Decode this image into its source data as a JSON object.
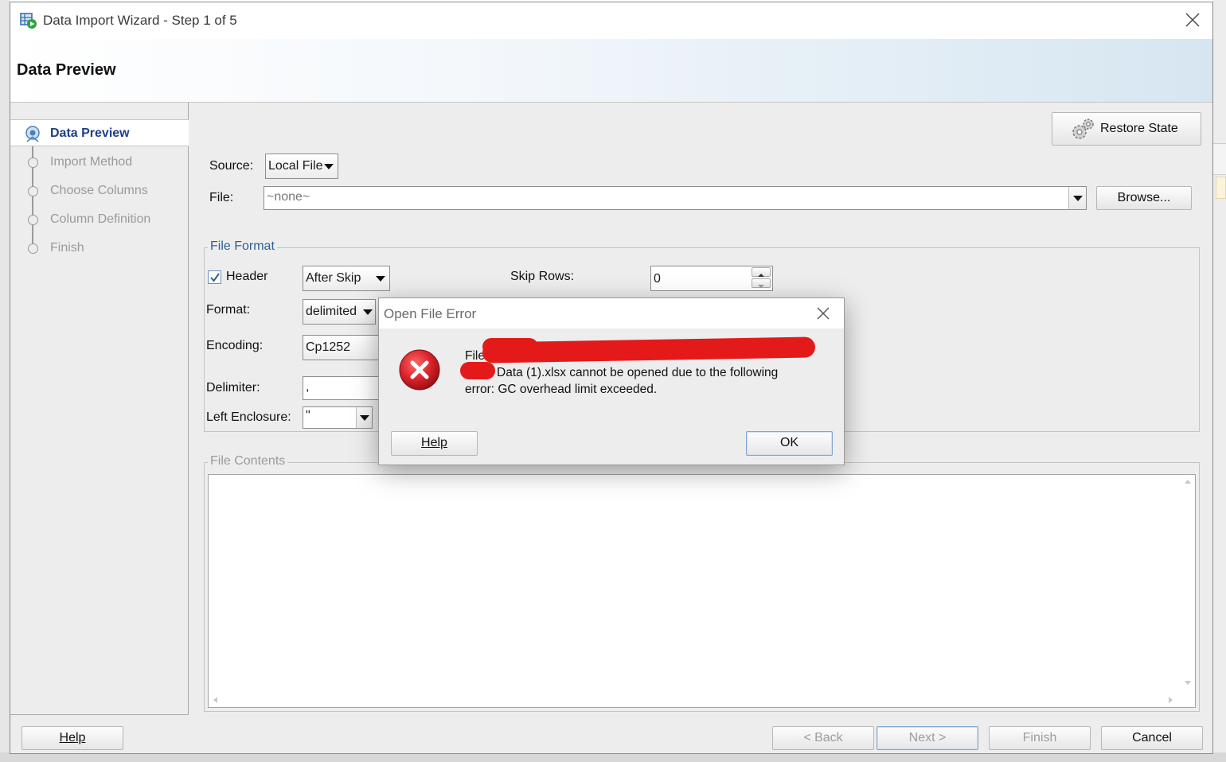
{
  "window": {
    "title": "Data Import Wizard - Step 1 of 5",
    "header_title": "Data Preview"
  },
  "nav": {
    "items": [
      {
        "label": "Data Preview",
        "state": "active"
      },
      {
        "label": "Import Method",
        "state": "disabled"
      },
      {
        "label": "Choose Columns",
        "state": "disabled"
      },
      {
        "label": "Column Definition",
        "state": "disabled"
      },
      {
        "label": "Finish",
        "state": "disabled"
      }
    ]
  },
  "toolbar": {
    "restore_state_label": "Restore State"
  },
  "source": {
    "label": "Source:",
    "value": "Local File"
  },
  "file": {
    "label": "File:",
    "value": "~none~",
    "browse_label": "Browse..."
  },
  "file_format": {
    "title": "File Format",
    "header_label": "Header",
    "header_checked": true,
    "header_option": "After Skip",
    "skip_rows_label": "Skip Rows:",
    "skip_rows_value": "0",
    "format_label": "Format:",
    "format_value": "delimited",
    "encoding_label": "Encoding:",
    "encoding_value": "Cp1252",
    "delimiter_label": "Delimiter:",
    "delimiter_value": ",",
    "left_enclosure_label": "Left Enclosure:",
    "left_enclosure_value": "\""
  },
  "file_contents": {
    "title": "File Contents"
  },
  "footer": {
    "help_label": "Help",
    "back_label": "< Back",
    "next_label": "Next >",
    "finish_label": "Finish",
    "cancel_label": "Cancel"
  },
  "error_dialog": {
    "title": "Open File Error",
    "line1_prefix": "File",
    "line2": "Data (1).xlsx cannot be opened due to the following",
    "line3": "error: GC overhead limit exceeded.",
    "help_label": "Help",
    "ok_label": "OK",
    "icon": "error-x-icon",
    "icon_color": "#d9232a"
  },
  "colors": {
    "accent": "#1d3f8a",
    "group_title": "#2f5f96",
    "redaction": "#e41a1a"
  }
}
